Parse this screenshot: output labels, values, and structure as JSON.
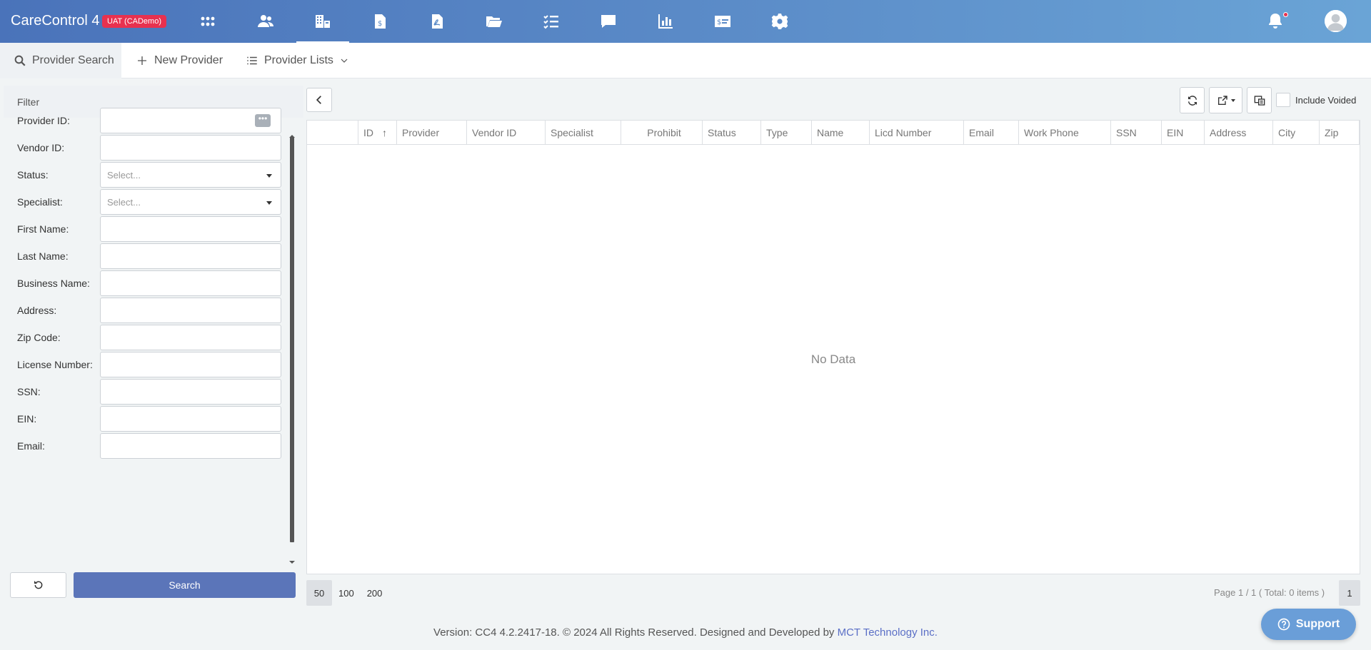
{
  "app": {
    "title": "CareControl 4",
    "env_badge": "UAT (CADemo)"
  },
  "nav": {
    "icons": [
      "apps-icon",
      "people-icon",
      "providers-icon",
      "billing-icon",
      "documents-icon",
      "folder-icon",
      "tasks-icon",
      "messages-icon",
      "reports-icon",
      "payments-icon",
      "settings-icon"
    ],
    "active": "providers-icon"
  },
  "toolbar": {
    "search_label": "Provider Search",
    "new_label": "New Provider",
    "lists_label": "Provider Lists"
  },
  "filter": {
    "heading": "Filter",
    "fields": [
      {
        "label": "Provider ID:",
        "type": "lookup",
        "value": ""
      },
      {
        "label": "Vendor ID:",
        "type": "text",
        "value": ""
      },
      {
        "label": "Status:",
        "type": "select",
        "placeholder": "Select..."
      },
      {
        "label": "Specialist:",
        "type": "select",
        "placeholder": "Select..."
      },
      {
        "label": "First Name:",
        "type": "text",
        "value": ""
      },
      {
        "label": "Last Name:",
        "type": "text",
        "value": ""
      },
      {
        "label": "Business Name:",
        "type": "text",
        "value": ""
      },
      {
        "label": "Address:",
        "type": "text",
        "value": ""
      },
      {
        "label": "Zip Code:",
        "type": "text",
        "value": ""
      },
      {
        "label": "License Number:",
        "type": "text",
        "value": ""
      },
      {
        "label": "SSN:",
        "type": "text",
        "value": ""
      },
      {
        "label": "EIN:",
        "type": "text",
        "value": ""
      },
      {
        "label": "Email:",
        "type": "text",
        "value": ""
      }
    ],
    "lookup_glyph": "•••",
    "search_label": "Search"
  },
  "grid": {
    "include_voided_label": "Include Voided",
    "columns": [
      "ID",
      "Provider",
      "Vendor ID",
      "Specialist",
      "Prohibit",
      "Status",
      "Type",
      "Name",
      "Licd Number",
      "Email",
      "Work Phone",
      "SSN",
      "EIN",
      "Address",
      "City",
      "Zip"
    ],
    "sort_glyph": "↑",
    "empty_text": "No Data",
    "page_sizes": [
      "50",
      "100",
      "200"
    ],
    "page_size_selected": "50",
    "page_info": "Page 1 / 1 ( Total: 0 items )",
    "current_page": "1"
  },
  "footer": {
    "text": "Version: CC4 4.2.2417-18. © 2024 All Rights Reserved. Designed and Developed by ",
    "link": "MCT Technology Inc."
  },
  "support": {
    "label": "Support"
  }
}
